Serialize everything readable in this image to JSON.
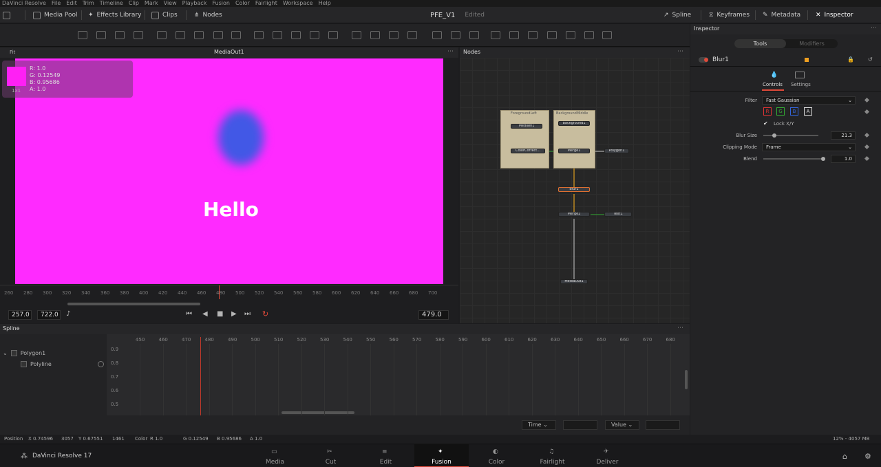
{
  "menu": [
    "DaVinci Resolve",
    "File",
    "Edit",
    "Trim",
    "Timeline",
    "Clip",
    "Mark",
    "View",
    "Playback",
    "Fusion",
    "Color",
    "Fairlight",
    "Workspace",
    "Help"
  ],
  "toolbar": {
    "media_pool": "Media Pool",
    "effects_library": "Effects Library",
    "clips": "Clips",
    "nodes": "Nodes",
    "project_title": "PFE_V1",
    "status": "Edited",
    "spline": "Spline",
    "keyframes": "Keyframes",
    "metadata": "Metadata",
    "inspector": "Inspector"
  },
  "viewer": {
    "fit_label": "Fit",
    "title": "MediaOut1",
    "overlay_text": "Hello",
    "pixel": {
      "r": "R: 1.0",
      "g": "G: 0.12549",
      "b": "B: 0.95686",
      "a": "A: 1.0",
      "scale": "1x1"
    },
    "ruler_ticks": [
      "260",
      "280",
      "300",
      "320",
      "340",
      "360",
      "380",
      "400",
      "420",
      "440",
      "460",
      "480",
      "500",
      "520",
      "540",
      "560",
      "580",
      "600",
      "620",
      "640",
      "660",
      "680",
      "700"
    ],
    "in_point": "257.0",
    "out_point": "722.0",
    "current_frame": "479.0"
  },
  "nodes_panel": {
    "title": "Nodes",
    "groups": [
      {
        "label": "ForegroundLeft"
      },
      {
        "label": "BackgroundMiddle"
      }
    ],
    "nodes": [
      "MediaIn1",
      "ColorCorrect...",
      "Background1",
      "Merge1",
      "Polygon1",
      "Blur1",
      "Merge2",
      "Text1",
      "MediaOut1"
    ]
  },
  "spline": {
    "title": "Spline",
    "tree": [
      {
        "label": "Polygon1"
      },
      {
        "label": "Polyline"
      }
    ],
    "ticks": [
      "450",
      "460",
      "470",
      "480",
      "490",
      "500",
      "510",
      "520",
      "530",
      "540",
      "550",
      "560",
      "570",
      "580",
      "590",
      "600",
      "610",
      "620",
      "630",
      "640",
      "650",
      "660",
      "670",
      "680"
    ],
    "values": [
      "0.9",
      "0.8",
      "0.7",
      "0.6",
      "0.5"
    ],
    "time_label": "Time",
    "value_label": "Value"
  },
  "status": {
    "position": "Position",
    "x": "X 0.74596",
    "x_px": "3057",
    "y": "Y 0.67551",
    "y_px": "1461",
    "color": "Color",
    "r": "R 1.0",
    "g": "G 0.12549",
    "b": "B 0.95686",
    "a": "A 1.0",
    "memory": "12% - 4057 MB"
  },
  "pages": {
    "app_name": "DaVinci Resolve 17",
    "items": [
      "Media",
      "Cut",
      "Edit",
      "Fusion",
      "Color",
      "Fairlight",
      "Deliver"
    ],
    "active": "Fusion"
  },
  "inspector": {
    "title": "Inspector",
    "tab_tools": "Tools",
    "tab_modifiers": "Modifiers",
    "node_name": "Blur1",
    "sub_controls": "Controls",
    "sub_settings": "Settings",
    "filter_label": "Filter",
    "filter_value": "Fast Gaussian",
    "channels": [
      "R",
      "G",
      "B",
      "A"
    ],
    "lock_xy": "Lock X/Y",
    "blur_size_label": "Blur Size",
    "blur_size_value": "21.3",
    "blur_size_fraction": 0.2,
    "clipping_label": "Clipping Mode",
    "clipping_value": "Frame",
    "blend_label": "Blend",
    "blend_value": "1.0",
    "blend_fraction": 1.0
  },
  "colors": {
    "canvas": "#ff2aff",
    "blob": "#4258e6",
    "accent": "#e04a3a"
  }
}
